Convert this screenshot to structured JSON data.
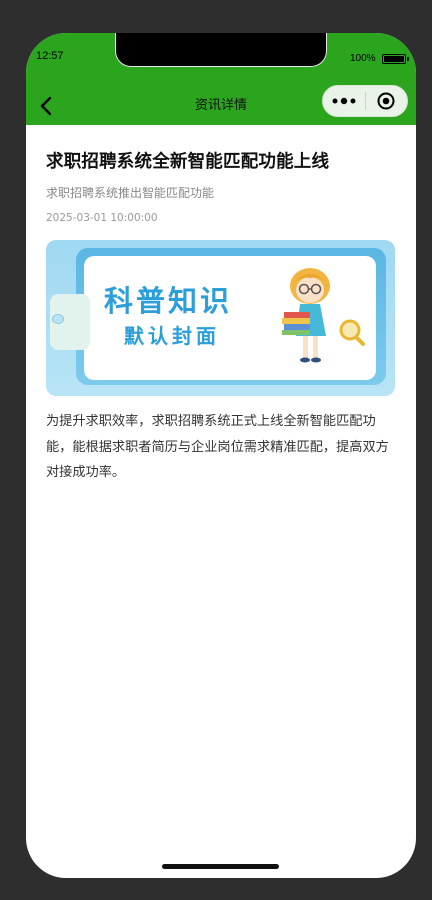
{
  "status_bar": {
    "time": "12:57",
    "battery": "100%"
  },
  "nav": {
    "title": "资讯详情",
    "back_icon": "chevron-left-icon",
    "more_icon": "more-dots-icon",
    "target_icon": "target-icon"
  },
  "article": {
    "title": "求职招聘系统全新智能匹配功能上线",
    "subtitle": "求职招聘系统推出智能匹配功能",
    "date": "2025-03-01 10:00:00",
    "cover": {
      "title": "科普知识",
      "subtitle": "默认封面"
    },
    "body": "为提升求职效率，求职招聘系统正式上线全新智能匹配功能，能根据求职者简历与企业岗位需求精准匹配，提高双方对接成功率。"
  },
  "colors": {
    "header": "#2aa51d",
    "cover_accent": "#2c9fdb"
  }
}
